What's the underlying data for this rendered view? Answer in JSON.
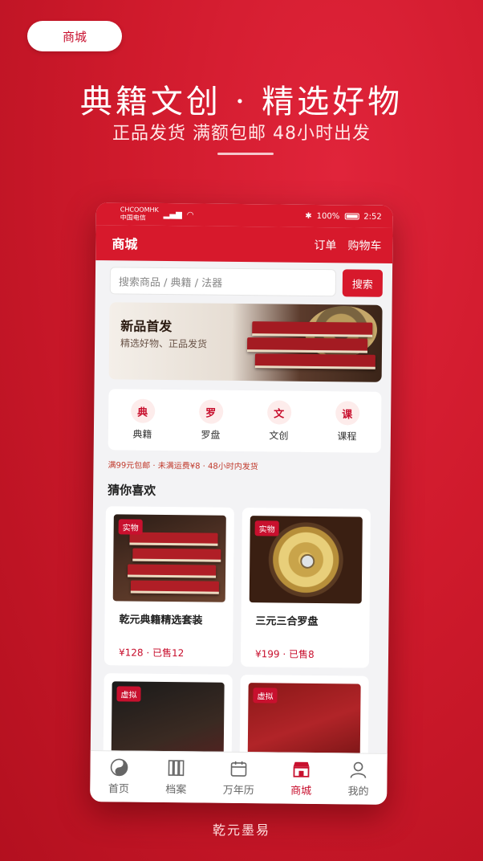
{
  "tag": "商城",
  "headline": "典籍文创 · 精选好物",
  "subline": "正品发货 满额包邮 48小时出发",
  "footer_brand": "乾元墨易",
  "status_bar": {
    "carrier_top": "CHCOOMHK",
    "carrier_bottom": "中国电信",
    "battery": "100%",
    "time": "2:52"
  },
  "appbar": {
    "title": "商城",
    "orders": "订单",
    "cart": "购物车"
  },
  "search": {
    "placeholder": "搜索商品 / 典籍 / 法器",
    "button": "搜索"
  },
  "banner": {
    "title": "新品首发",
    "subtitle": "精选好物、正品发货"
  },
  "categories": [
    {
      "icon_char": "典",
      "label": "典籍"
    },
    {
      "icon_char": "罗",
      "label": "罗盘"
    },
    {
      "icon_char": "文",
      "label": "文创"
    },
    {
      "icon_char": "课",
      "label": "课程"
    }
  ],
  "shipping_note": "满99元包邮 · 未满运费¥8 · 48小时内发货",
  "section_title": "猜你喜欢",
  "products": [
    {
      "badge": "实物",
      "title": "乾元典籍精选套装",
      "price": "¥128 · 已售12"
    },
    {
      "badge": "实物",
      "title": "三元三合罗盘",
      "price": "¥199 · 已售8"
    },
    {
      "badge": "虚拟"
    },
    {
      "badge": "虚拟"
    }
  ],
  "tabs": [
    {
      "label": "首页",
      "icon": "yin-yang-icon"
    },
    {
      "label": "档案",
      "icon": "archive-icon"
    },
    {
      "label": "万年历",
      "icon": "calendar-icon"
    },
    {
      "label": "商城",
      "icon": "shop-icon"
    },
    {
      "label": "我的",
      "icon": "user-icon"
    }
  ],
  "colors": {
    "brand_red": "#c8102e",
    "appbar_red": "#d7192c"
  }
}
